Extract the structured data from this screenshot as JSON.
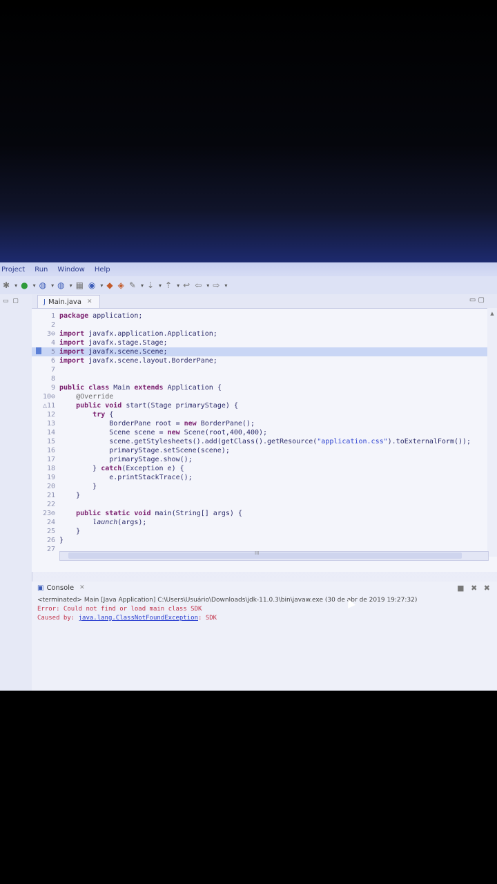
{
  "menubar": {
    "items": [
      "Project",
      "Run",
      "Window",
      "Help"
    ]
  },
  "editor": {
    "tab_title": "Main.java",
    "lines": [
      {
        "n": "1",
        "text": "package application;"
      },
      {
        "n": "2",
        "text": ""
      },
      {
        "n": "3⊖",
        "text": "import javafx.application.Application;"
      },
      {
        "n": "4",
        "text": "import javafx.stage.Stage;"
      },
      {
        "n": "5",
        "text": "import javafx.scene.Scene;"
      },
      {
        "n": "6",
        "text": "import javafx.scene.layout.BorderPane;"
      },
      {
        "n": "7",
        "text": ""
      },
      {
        "n": "8",
        "text": ""
      },
      {
        "n": "9",
        "text": "public class Main extends Application {"
      },
      {
        "n": "10⊖",
        "text": "    @Override"
      },
      {
        "n": "△11",
        "text": "    public void start(Stage primaryStage) {"
      },
      {
        "n": "12",
        "text": "        try {"
      },
      {
        "n": "13",
        "text": "            BorderPane root = new BorderPane();"
      },
      {
        "n": "14",
        "text": "            Scene scene = new Scene(root,400,400);"
      },
      {
        "n": "15",
        "text": "            scene.getStylesheets().add(getClass().getResource(\"application.css\").toExternalForm());"
      },
      {
        "n": "16",
        "text": "            primaryStage.setScene(scene);"
      },
      {
        "n": "17",
        "text": "            primaryStage.show();"
      },
      {
        "n": "18",
        "text": "        } catch(Exception e) {"
      },
      {
        "n": "19",
        "text": "            e.printStackTrace();"
      },
      {
        "n": "20",
        "text": "        }"
      },
      {
        "n": "21",
        "text": "    }"
      },
      {
        "n": "22",
        "text": ""
      },
      {
        "n": "23⊖",
        "text": "    public static void main(String[] args) {"
      },
      {
        "n": "24",
        "text": "        launch(args);"
      },
      {
        "n": "25",
        "text": "    }"
      },
      {
        "n": "26",
        "text": "}"
      },
      {
        "n": "27",
        "text": ""
      }
    ]
  },
  "console": {
    "title": "Console",
    "terminated": "<terminated> Main [Java Application] C:\\Users\\Usuário\\Downloads\\jdk-11.0.3\\bin\\javaw.exe (30 de abr de 2019 19:27:32)",
    "error_line": "Error: Could not find or load main class SDK",
    "caused_prefix": "Caused by: ",
    "caused_link": "java.lang.ClassNotFoundException",
    "caused_suffix": ": SDK"
  },
  "colors": {
    "keyword": "#7a1f6e",
    "string": "#2a3fd0",
    "error": "#c2334a",
    "highlight": "#c9d6f5"
  }
}
